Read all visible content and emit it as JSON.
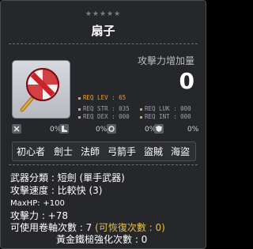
{
  "stars": "★★★★★",
  "item_name": "扇子",
  "attack_increase": {
    "label": "攻擊力增加量",
    "value": "0"
  },
  "requirements": {
    "lev": "REQ LEV :  65",
    "str": "REQ STR : 035",
    "luk": "REQ LUK : 000",
    "dex": "REQ DEX : 000",
    "int": "REQ INT : 000"
  },
  "stat_icons": [
    "0%",
    "0%",
    "0%",
    "0%"
  ],
  "jobs": [
    "初心者",
    "劍士",
    "法師",
    "弓箭手",
    "盜賊",
    "海盜"
  ],
  "description": {
    "weapon_type": "武器分類 : 短劍 (單手武器)",
    "attack_speed": "攻擊速度 : 比較快 (3)",
    "maxhp_label": "MaxHP:",
    "maxhp_value": "+100",
    "attack": "攻擊力 : +78",
    "upgrades_prefix": "可使用卷軸次數 : 7",
    "upgrades_recoverable": "(可恢復次數 : 0)",
    "hammer": "黃金鐵槌強化次數 : 0"
  },
  "colors": {
    "background": "#26272b",
    "requirement_highlight": "#e8a234",
    "recoverable_text": "#e6c04a"
  }
}
